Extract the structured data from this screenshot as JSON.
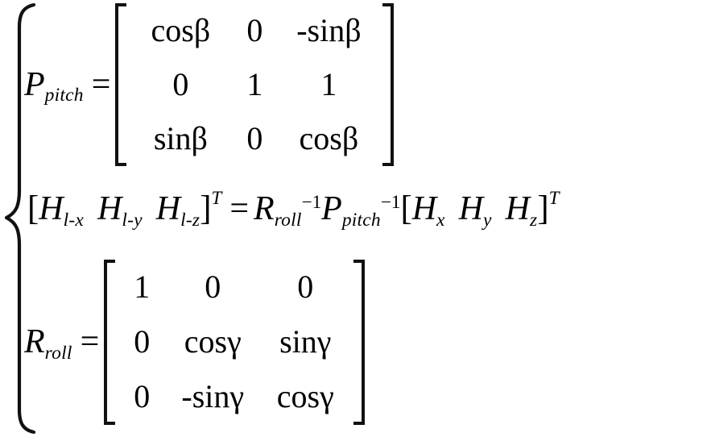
{
  "figure": {
    "kind": "math-equation-system",
    "background_color": "#ffffff",
    "text_color": "#000000",
    "brace": "left-curly-brace"
  },
  "equations": {
    "pitch": {
      "lhs_symbol": "P",
      "lhs_subscript": "pitch",
      "equals": "=",
      "matrix": {
        "rows": 3,
        "cols": 3,
        "cells": [
          [
            "cos",
            "0",
            "-sin"
          ],
          [
            "0",
            "1",
            "1"
          ],
          [
            "sin",
            "0",
            "cos"
          ]
        ],
        "angle": "β",
        "cells_rendered": [
          [
            "cosβ",
            "0",
            "-sinβ"
          ],
          [
            "0",
            "1",
            "1"
          ],
          [
            "sinβ",
            "0",
            "cosβ"
          ]
        ]
      }
    },
    "vector": {
      "open_bracket": "[",
      "close_bracket": "]",
      "lhs_terms": [
        {
          "symbol": "H",
          "subscript": "l-x"
        },
        {
          "symbol": "H",
          "subscript": "l-y"
        },
        {
          "symbol": "H",
          "subscript": "l-z"
        }
      ],
      "lhs_transpose": "T",
      "equals": "=",
      "rhs_factors": [
        {
          "symbol": "R",
          "subscript": "roll",
          "superscript": "−1"
        },
        {
          "symbol": "P",
          "subscript": "pitch",
          "superscript": "−1"
        }
      ],
      "rhs_terms": [
        {
          "symbol": "H",
          "subscript": "x"
        },
        {
          "symbol": "H",
          "subscript": "y"
        },
        {
          "symbol": "H",
          "subscript": "z"
        }
      ],
      "rhs_transpose": "T"
    },
    "roll": {
      "lhs_symbol": "R",
      "lhs_subscript": "roll",
      "equals": "=",
      "matrix": {
        "rows": 3,
        "cols": 3,
        "cells": [
          [
            "1",
            "0",
            "0"
          ],
          [
            "0",
            "cos",
            "sin"
          ],
          [
            "0",
            "-sin",
            "cos"
          ]
        ],
        "angle": "γ",
        "cells_rendered": [
          [
            "1",
            "0",
            "0"
          ],
          [
            "0",
            "cosγ",
            "sinγ"
          ],
          [
            "0",
            "-sinγ",
            "cosγ"
          ]
        ]
      }
    }
  }
}
